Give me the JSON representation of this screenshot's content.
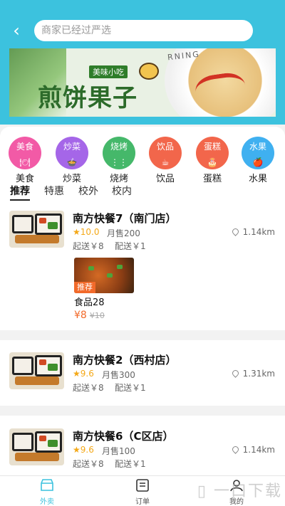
{
  "header": {
    "search_placeholder": "商家已经过严选",
    "banner": {
      "sign": "美味小吃",
      "title": "煎饼果子",
      "ring_text": "RNING"
    }
  },
  "categories": [
    {
      "name": "美食",
      "color": "#f25aa6"
    },
    {
      "name": "炒菜",
      "color": "#a566e8"
    },
    {
      "name": "烧烤",
      "color": "#45b86a"
    },
    {
      "name": "饮品",
      "color": "#f2664b"
    },
    {
      "name": "蛋糕",
      "color": "#f2664b"
    },
    {
      "name": "水果",
      "color": "#3fb0f0"
    }
  ],
  "subtabs": [
    "推荐",
    "特惠",
    "校外",
    "校内"
  ],
  "shops": [
    {
      "name": "南方快餐7（南门店）",
      "rating": "10.0",
      "sales": "月售200",
      "distance": "1.14km",
      "min_order": "起送￥8",
      "delivery": "配送￥1",
      "dish": {
        "tag": "推荐",
        "name": "食品28",
        "price": "8",
        "orig": "10",
        "currency": "¥"
      }
    },
    {
      "name": "南方快餐2（西村店）",
      "rating": "9.6",
      "sales": "月售300",
      "distance": "1.31km",
      "min_order": "起送￥8",
      "delivery": "配送￥1"
    },
    {
      "name": "南方快餐6（C区店）",
      "rating": "9.6",
      "sales": "月售100",
      "distance": "1.14km",
      "min_order": "起送￥8",
      "delivery": "配送￥1"
    }
  ],
  "tabbar": [
    {
      "label": "外卖"
    },
    {
      "label": "订单"
    },
    {
      "label": "我的"
    }
  ],
  "watermark": "一口下载",
  "colors": {
    "accent": "#3cc2de",
    "price": "#f26a2a",
    "star": "#f4a817"
  }
}
